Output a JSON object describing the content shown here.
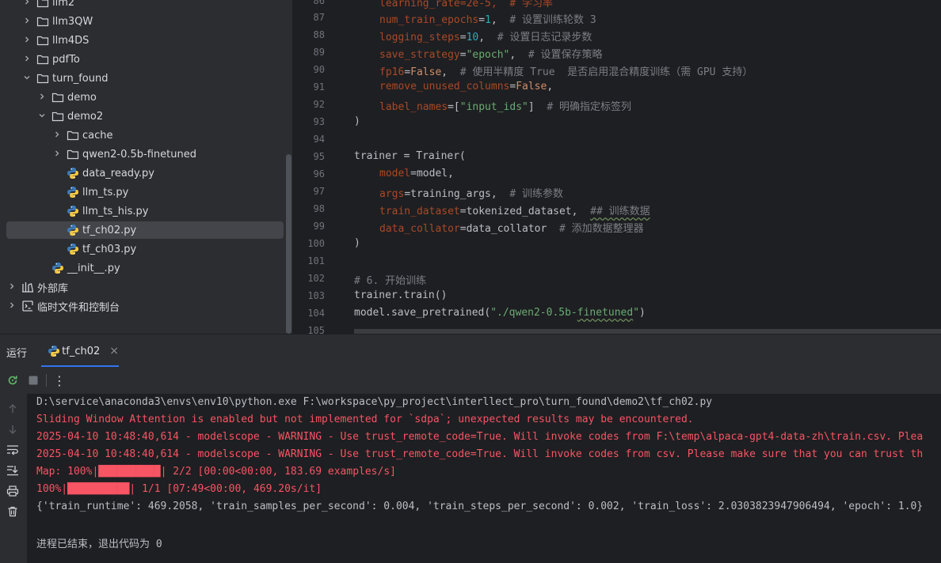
{
  "tree": {
    "items": [
      {
        "label": "llm2",
        "indent": 1,
        "type": "folder",
        "open": false
      },
      {
        "label": "llm3QW",
        "indent": 1,
        "type": "folder",
        "open": false
      },
      {
        "label": "llm4DS",
        "indent": 1,
        "type": "folder",
        "open": false
      },
      {
        "label": "pdfTo",
        "indent": 1,
        "type": "folder",
        "open": false
      },
      {
        "label": "turn_found",
        "indent": 1,
        "type": "folder",
        "open": true
      },
      {
        "label": "demo",
        "indent": 2,
        "type": "folder",
        "open": false
      },
      {
        "label": "demo2",
        "indent": 2,
        "type": "folder",
        "open": true
      },
      {
        "label": "cache",
        "indent": 3,
        "type": "folder",
        "open": false
      },
      {
        "label": "qwen2-0.5b-finetuned",
        "indent": 3,
        "type": "folder",
        "open": false
      },
      {
        "label": "data_ready.py",
        "indent": 3,
        "type": "py"
      },
      {
        "label": "llm_ts.py",
        "indent": 3,
        "type": "py"
      },
      {
        "label": "llm_ts_his.py",
        "indent": 3,
        "type": "py"
      },
      {
        "label": "tf_ch02.py",
        "indent": 3,
        "type": "py",
        "selected": true
      },
      {
        "label": "tf_ch03.py",
        "indent": 3,
        "type": "py"
      },
      {
        "label": "__init__.py",
        "indent": 2,
        "type": "py"
      },
      {
        "label": "外部库",
        "indent": 0,
        "type": "lib"
      },
      {
        "label": "临时文件和控制台",
        "indent": 0,
        "type": "scratch"
      }
    ]
  },
  "editor": {
    "line_numbers": [
      "87",
      "88",
      "89",
      "90",
      "91",
      "92",
      "93",
      "94",
      "95",
      "96",
      "97",
      "98",
      "99",
      "100",
      "101",
      "102",
      "103",
      "104",
      "105"
    ],
    "top_line_number": "86",
    "top_line_text": "learning_rate=2e-5,  # 学习率",
    "lines": {
      "l87": {
        "p": "num_train_epochs",
        "eq": "=",
        "v": "1",
        "rest": ",  ",
        "c": "# 设置训练轮数 3"
      },
      "l88": {
        "p": "logging_steps",
        "eq": "=",
        "v": "10",
        "rest": ",  ",
        "c": "# 设置日志记录步数"
      },
      "l89": {
        "p": "save_strategy",
        "eq": "=",
        "v": "\"epoch\"",
        "rest": ",  ",
        "c": "# 设置保存策略"
      },
      "l90": {
        "p": "fp16",
        "eq": "=",
        "v": "False",
        "rest": ",  ",
        "c": "# 使用半精度 True  是否启用混合精度训练（需 GPU 支持）"
      },
      "l91": {
        "p": "remove_unused_columns",
        "eq": "=",
        "v": "False",
        "rest": ","
      },
      "l92": {
        "p": "label_names",
        "eq": "=[",
        "v": "\"input_ids\"",
        "rest": "]  ",
        "c": "# 明确指定标签列"
      },
      "l93": ")",
      "l95": "trainer = Trainer(",
      "l96": {
        "p": "model",
        "eq": "=",
        "v": "model",
        "rest": ","
      },
      "l97": {
        "p": "args",
        "eq": "=",
        "v": "training_args",
        "rest": ",  ",
        "c": "# 训练参数"
      },
      "l98": {
        "p": "train_dataset",
        "eq": "=",
        "v": "tokenized_dataset",
        "rest": ",  ",
        "c": "## 训练数据"
      },
      "l99": {
        "p": "data_collator",
        "eq": "=",
        "v": "data_collator",
        "rest": "  ",
        "c": "# 添加数据整理器"
      },
      "l100": ")",
      "l102": "# 6. 开始训练",
      "l103": "trainer.train()",
      "l104a": "model.save_pretrained(",
      "l104b": "\"./qwen2-0.5b-",
      "l104c": "finetuned",
      "l104d": "\"",
      "l104e": ")"
    }
  },
  "run": {
    "title": "运行",
    "tab_label": "tf_ch02",
    "tab_close": "×",
    "menu_glyph": "⋮"
  },
  "console": {
    "cmd": "D:\\service\\anaconda3\\envs\\env10\\python.exe F:\\workspace\\py_project\\interllect_pro\\turn_found\\demo2\\tf_ch02.py",
    "warn1": "Sliding Window Attention is enabled but not implemented for `sdpa`; unexpected results may be encountered.",
    "warn2": "2025-04-10 10:48:40,614 - modelscope - WARNING - Use trust_remote_code=True. Will invoke codes from F:\\temp\\alpaca-gpt4-data-zh\\train.csv. Plea",
    "warn3": "2025-04-10 10:48:40,614 - modelscope - WARNING - Use trust_remote_code=True. Will invoke codes from csv. Please make sure that you can trust th",
    "map_prefix": "Map: 100%|",
    "map_bar": "██████████",
    "map_suffix": "| 2/2 [00:00<00:00, 183.69 examples/s]",
    "train_prefix": "100%|",
    "train_bar": "██████████",
    "train_suffix": "| 1/1 [07:49<00:00, 469.20s/it]",
    "result": "{'train_runtime': 469.2058, 'train_samples_per_second': 0.004, 'train_steps_per_second': 0.002, 'train_loss': 2.0303823947906494, 'epoch': 1.0}",
    "exit": "进程已结束，退出代码为 0"
  }
}
